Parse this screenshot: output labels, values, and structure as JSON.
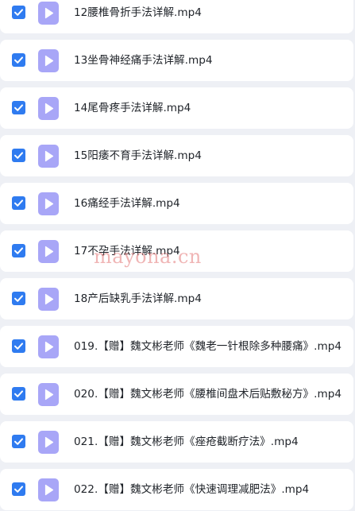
{
  "colors": {
    "background": "#eef0f5",
    "row_background": "#ffffff",
    "checkbox": "#2f7bf0",
    "video_icon": "#a8a6f7",
    "text": "#1f2329",
    "watermark": "#e47878"
  },
  "files": [
    {
      "name": "12腰椎骨折手法详解.mp4",
      "checked": true,
      "icon": "video-file-icon"
    },
    {
      "name": "13坐骨神经痛手法详解.mp4",
      "checked": true,
      "icon": "video-file-icon"
    },
    {
      "name": "14尾骨疼手法详解.mp4",
      "checked": true,
      "icon": "video-file-icon"
    },
    {
      "name": "15阳痿不育手法详解.mp4",
      "checked": true,
      "icon": "video-file-icon"
    },
    {
      "name": "16痛经手法详解.mp4",
      "checked": true,
      "icon": "video-file-icon"
    },
    {
      "name": "17不孕手法详解.mp4",
      "checked": true,
      "icon": "video-file-icon"
    },
    {
      "name": "18产后缺乳手法详解.mp4",
      "checked": true,
      "icon": "video-file-icon"
    },
    {
      "name": "019.【赠】魏文彬老师《魏老一针根除多种腰痛》.mp4",
      "checked": true,
      "icon": "video-file-icon"
    },
    {
      "name": "020.【赠】魏文彬老师《腰椎间盘术后贴敷秘方》.mp4",
      "checked": true,
      "icon": "video-file-icon"
    },
    {
      "name": "021.【赠】魏文彬老师《痤疮截断疗法》.mp4",
      "checked": true,
      "icon": "video-file-icon"
    },
    {
      "name": "022.【赠】魏文彬老师《快速调理减肥法》.mp4",
      "checked": true,
      "icon": "video-file-icon"
    }
  ],
  "watermark": "mayona.cn"
}
